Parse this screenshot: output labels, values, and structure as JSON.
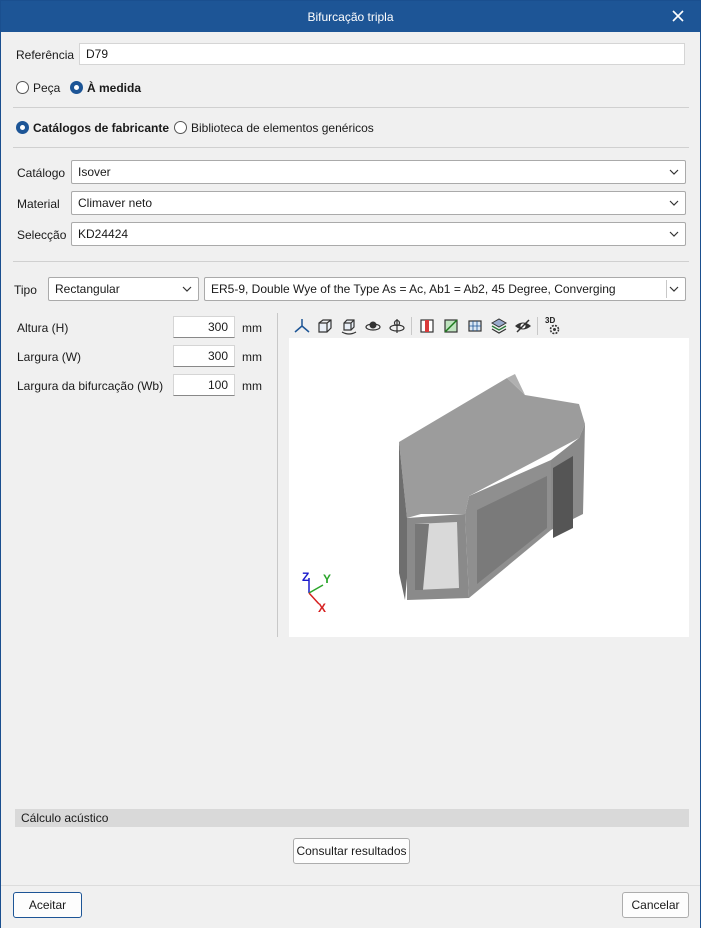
{
  "window": {
    "title": "Bifurcação tripla"
  },
  "referencia": {
    "label": "Referência",
    "value": "D79"
  },
  "mode": {
    "peca": "Peça",
    "medida": "À medida",
    "selected": "medida"
  },
  "source": {
    "catalogos": "Catálogos de fabricante",
    "biblioteca": "Biblioteca de elementos genéricos",
    "selected": "catalogos"
  },
  "catalogo": {
    "label": "Catálogo",
    "value": "Isover"
  },
  "material": {
    "label": "Material",
    "value": "Climaver neto"
  },
  "seleccao": {
    "label": "Selecção",
    "value": "KD24424"
  },
  "tipo": {
    "label": "Tipo",
    "shape": "Rectangular",
    "model": "ER5-9, Double Wye of the Type As = Ac, Ab1 = Ab2, 45 Degree, Converging"
  },
  "dims": [
    {
      "label": "Altura (H)",
      "value": "300",
      "unit": "mm"
    },
    {
      "label": "Largura (W)",
      "value": "300",
      "unit": "mm"
    },
    {
      "label": "Largura da bifurcação (Wb)",
      "value": "100",
      "unit": "mm"
    }
  ],
  "toolbar": {
    "icons": [
      "axes-icon",
      "cube-icon",
      "cube-rotate-icon",
      "orbit-icon",
      "rotate-axis-icon",
      "section-icon",
      "clip-icon",
      "grid-icon",
      "layers-icon",
      "visibility-icon",
      "3d-settings-icon"
    ],
    "label_3d": "3D"
  },
  "axes": {
    "z": "Z",
    "y": "Y",
    "x": "X"
  },
  "acoustic": {
    "section_title": "Cálculo acústico",
    "button": "Consultar resultados"
  },
  "footer": {
    "accept": "Aceitar",
    "cancel": "Cancelar"
  },
  "colors": {
    "titlebar": "#1d5596",
    "accent": "#1d5596",
    "model_gray": "#8f8f8f"
  }
}
